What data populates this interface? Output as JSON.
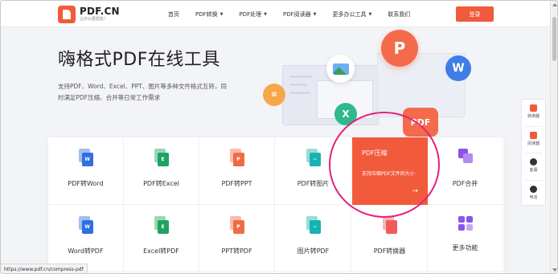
{
  "header": {
    "logo_name": "PDF.CN",
    "logo_slogan": "让办公更轻松！",
    "nav": [
      {
        "label": "首页",
        "has_caret": false
      },
      {
        "label": "PDF转换",
        "has_caret": true
      },
      {
        "label": "PDF处理",
        "has_caret": true
      },
      {
        "label": "PDF阅读器",
        "has_caret": true
      },
      {
        "label": "更多办公工具",
        "has_caret": true
      },
      {
        "label": "联系我们",
        "has_caret": false
      }
    ],
    "caret": "▼",
    "login_label": "登录"
  },
  "hero": {
    "title": "嗨格式PDF在线工具",
    "description": "支持PDF、Word、Excel、PPT、图片等多种文件格式互转，同时满足PDF压缩、合并等日常工作需求"
  },
  "illustration": {
    "p_letter": "P",
    "w_letter": "W",
    "x_letter": "X",
    "pdf_badge": "PDF"
  },
  "tools": {
    "row1": [
      {
        "label": "PDF转Word",
        "icon": "word-icon",
        "letter": "W",
        "color": "#2f6fe0"
      },
      {
        "label": "PDF转Excel",
        "icon": "excel-icon",
        "letter": "E",
        "color": "#1ea362"
      },
      {
        "label": "PDF转PPT",
        "icon": "ppt-icon",
        "letter": "P",
        "color": "#f06a43"
      },
      {
        "label": "PDF转图片",
        "icon": "image-icon",
        "letter": "~",
        "color": "#18b3b0"
      }
    ],
    "featured": {
      "title": "PDF压缩",
      "description": "支持压缩PDF文件的大小",
      "arrow": "→"
    },
    "merge_label": "PDF合并",
    "row2": [
      {
        "label": "Word转PDF",
        "icon": "word-icon",
        "letter": "W",
        "color": "#2f6fe0"
      },
      {
        "label": "Excel转PDF",
        "icon": "excel-icon",
        "letter": "E",
        "color": "#1ea362"
      },
      {
        "label": "PPT转PDF",
        "icon": "ppt-icon",
        "letter": "P",
        "color": "#f06a43"
      },
      {
        "label": "图片转PDF",
        "icon": "image-icon",
        "letter": "~",
        "color": "#18b3b0"
      },
      {
        "label": "PDF转换器",
        "icon": "converter-icon",
        "letter": "",
        "color": "#f05a5a"
      },
      {
        "label": "更多功能",
        "icon": "more-icon",
        "letter": "",
        "color": "#8a55e6"
      }
    ]
  },
  "float_bar": [
    {
      "label": "转换器",
      "icon": "converter-icon",
      "color": "#f25a3c"
    },
    {
      "label": "阅读器",
      "icon": "reader-icon",
      "color": "#f25a3c"
    },
    {
      "label": "客服",
      "icon": "chat-icon",
      "color": "#333333"
    },
    {
      "label": "电话",
      "icon": "phone-icon",
      "color": "#333333"
    }
  ],
  "status_url": "https://www.pdf.cn/compress-pdf",
  "colors": {
    "accent": "#f25a3c",
    "highlight_ring": "#e5207a"
  }
}
